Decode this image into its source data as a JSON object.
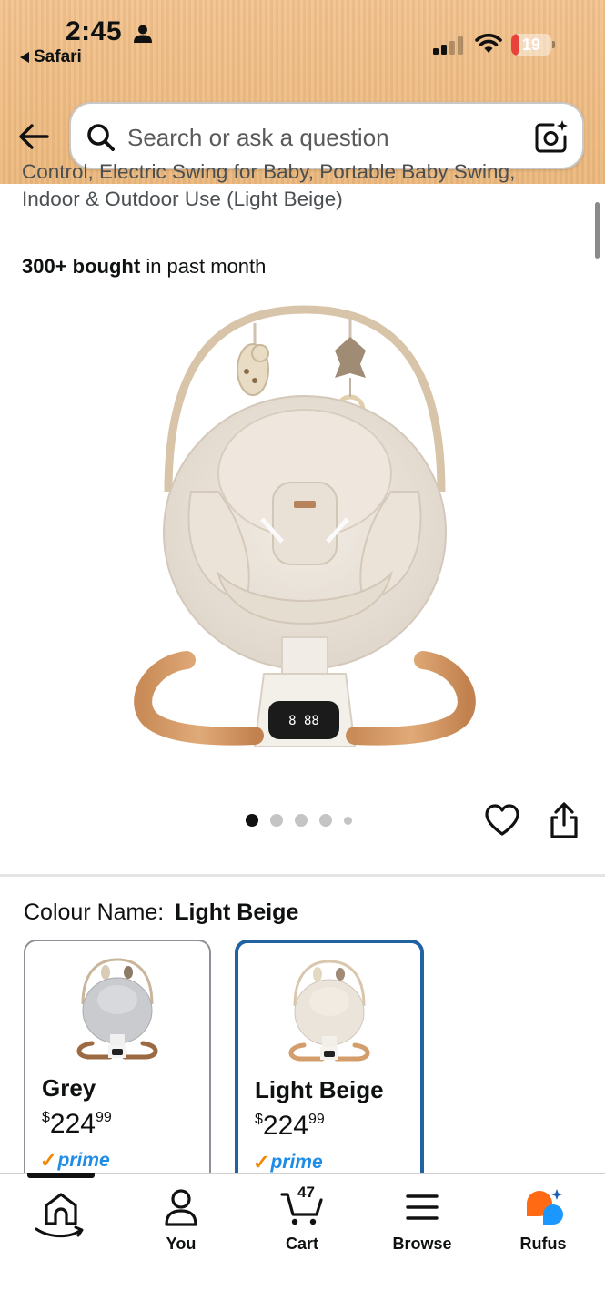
{
  "status_bar": {
    "time": "2:45",
    "back_app": "Safari",
    "battery": "19",
    "battery_level": 0.19,
    "battery_color": "#e8423a"
  },
  "search": {
    "placeholder": "Search or ask a question"
  },
  "product": {
    "title": "Control, Electric Swing for Baby, Portable Baby Swing, Indoor & Outdoor Use (Light Beige)",
    "bought_bold": "300+ bought",
    "bought_rest": "in past month",
    "image_name": "baby-swing-light-beige",
    "image_pages": 5,
    "image_page_current": 1,
    "display_readout": "8 88"
  },
  "colour": {
    "label": "Colour Name:",
    "selected": "Light Beige",
    "selected_border": "#2162a1",
    "options": [
      {
        "name": "Grey",
        "currency": "$",
        "price_main": "224",
        "price_cents": "99",
        "prime": "prime",
        "selected": false
      },
      {
        "name": "Light Beige",
        "currency": "$",
        "price_main": "224",
        "price_cents": "99",
        "prime": "prime",
        "selected": true
      }
    ]
  },
  "nav": {
    "items": [
      {
        "label": "",
        "icon": "home-icon"
      },
      {
        "label": "You",
        "icon": "person-icon"
      },
      {
        "label": "Cart",
        "icon": "cart-icon",
        "count": "47"
      },
      {
        "label": "Browse",
        "icon": "menu-icon"
      },
      {
        "label": "Rufus",
        "icon": "rufus-icon"
      }
    ]
  },
  "colors": {
    "header_bg": "#eebb82",
    "prime_blue": "#1f8ce6",
    "prime_check": "#f08804",
    "rufus_orange": "#ff6a13",
    "rufus_blue": "#1a98ff"
  }
}
